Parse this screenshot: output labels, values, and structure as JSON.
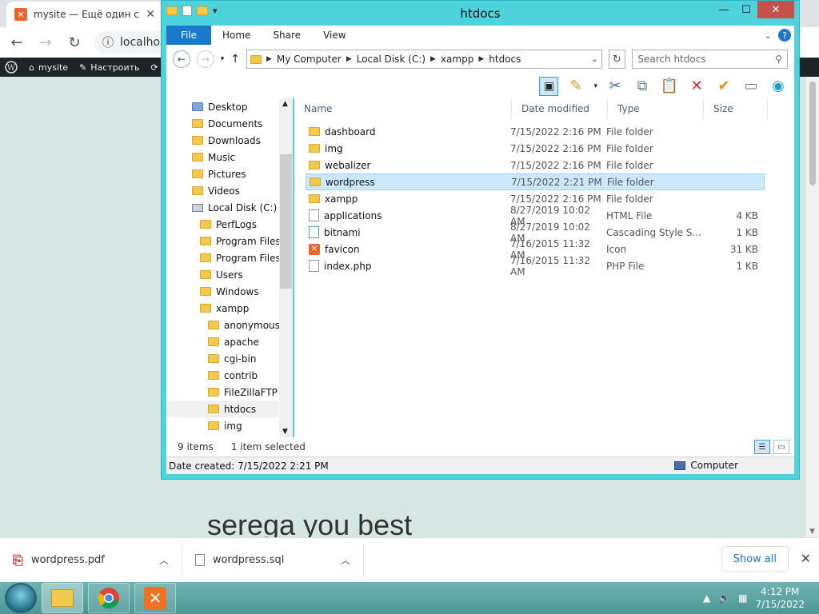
{
  "browser": {
    "tab_title": "mysite — Ещё один сайт",
    "url": "localhost/",
    "admin_bar": {
      "site_name": "mysite",
      "customize": "Настроить"
    },
    "page_heading": "serega you best"
  },
  "downloads": {
    "items": [
      {
        "name": "wordpress.pdf"
      },
      {
        "name": "wordpress.sql"
      }
    ],
    "show_all": "Show all"
  },
  "explorer": {
    "title": "htdocs",
    "ribbon_tabs": [
      "File",
      "Home",
      "Share",
      "View"
    ],
    "breadcrumb": [
      "My Computer",
      "Local Disk (C:)",
      "xampp",
      "htdocs"
    ],
    "search_placeholder": "Search htdocs",
    "nav_items": [
      {
        "label": "Desktop"
      },
      {
        "label": "Documents"
      },
      {
        "label": "Downloads"
      },
      {
        "label": "Music"
      },
      {
        "label": "Pictures"
      },
      {
        "label": "Videos"
      },
      {
        "label": "Local Disk (C:)"
      },
      {
        "label": "PerfLogs"
      },
      {
        "label": "Program Files"
      },
      {
        "label": "Program Files ("
      },
      {
        "label": "Users"
      },
      {
        "label": "Windows"
      },
      {
        "label": "xampp"
      },
      {
        "label": "anonymous"
      },
      {
        "label": "apache"
      },
      {
        "label": "cgi-bin"
      },
      {
        "label": "contrib"
      },
      {
        "label": "FileZillaFTP"
      },
      {
        "label": "htdocs"
      },
      {
        "label": "img"
      }
    ],
    "columns": {
      "name": "Name",
      "date": "Date modified",
      "type": "Type",
      "size": "Size"
    },
    "files": [
      {
        "name": "dashboard",
        "date": "7/15/2022 2:16 PM",
        "type": "File folder",
        "size": ""
      },
      {
        "name": "img",
        "date": "7/15/2022 2:16 PM",
        "type": "File folder",
        "size": ""
      },
      {
        "name": "webalizer",
        "date": "7/15/2022 2:16 PM",
        "type": "File folder",
        "size": ""
      },
      {
        "name": "wordpress",
        "date": "7/15/2022 2:21 PM",
        "type": "File folder",
        "size": ""
      },
      {
        "name": "xampp",
        "date": "7/15/2022 2:16 PM",
        "type": "File folder",
        "size": ""
      },
      {
        "name": "applications",
        "date": "8/27/2019 10:02 AM",
        "type": "HTML File",
        "size": "4 KB"
      },
      {
        "name": "bitnami",
        "date": "8/27/2019 10:02 AM",
        "type": "Cascading Style S...",
        "size": "1 KB"
      },
      {
        "name": "favicon",
        "date": "7/16/2015 11:32 AM",
        "type": "Icon",
        "size": "31 KB"
      },
      {
        "name": "index.php",
        "date": "7/16/2015 11:32 AM",
        "type": "PHP File",
        "size": "1 KB"
      }
    ],
    "status_items": "9 items",
    "status_selected": "1 item selected",
    "details_bar": "Date created: 7/15/2022 2:21 PM",
    "details_location": "Computer"
  },
  "taskbar": {
    "time": "4:12 PM",
    "date": "7/15/2022"
  }
}
